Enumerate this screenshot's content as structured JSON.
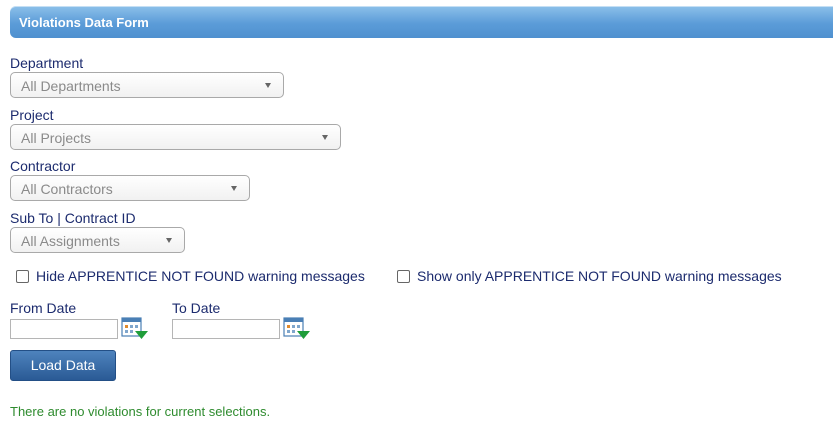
{
  "form": {
    "title": "Violations Data Form"
  },
  "fields": {
    "department": {
      "label": "Department",
      "selected": "All Departments"
    },
    "project": {
      "label": "Project",
      "selected": "All Projects"
    },
    "contractor": {
      "label": "Contractor",
      "selected": "All Contractors"
    },
    "sub_to": {
      "label": "Sub To | Contract ID",
      "selected": "All Assignments"
    }
  },
  "checkboxes": {
    "hide_apprentice": {
      "label": "Hide APPRENTICE NOT FOUND warning messages",
      "checked": false
    },
    "show_only_apprentice": {
      "label": "Show only APPRENTICE NOT FOUND warning messages",
      "checked": false
    }
  },
  "dates": {
    "from": {
      "label": "From Date",
      "value": ""
    },
    "to": {
      "label": "To Date",
      "value": ""
    }
  },
  "actions": {
    "load_label": "Load Data"
  },
  "status": {
    "message": "There are no violations for current selections."
  },
  "icons": {
    "dropdown": "chevron-down-icon",
    "calendar": "calendar-icon"
  },
  "colors": {
    "header_blue": "#5b9cd8",
    "label_navy": "#1c2b6e",
    "button_blue": "#2a5a95",
    "message_green": "#2e8b2e"
  }
}
